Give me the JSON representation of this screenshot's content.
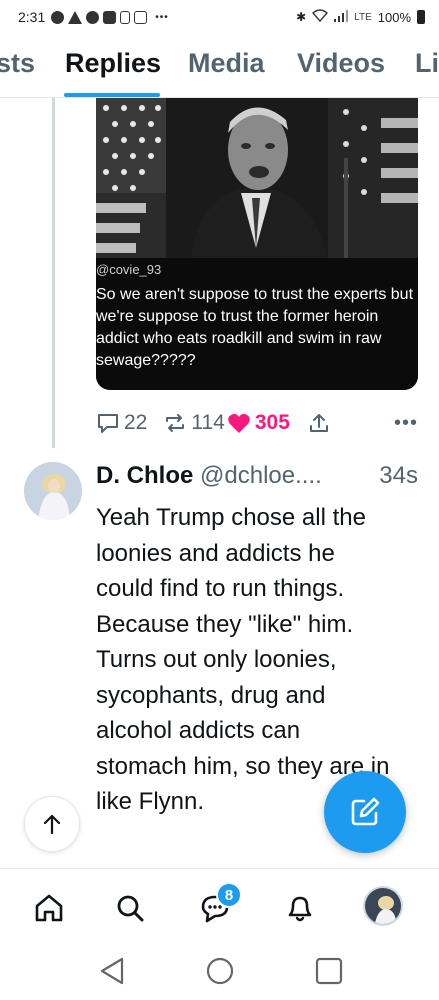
{
  "status_bar": {
    "time": "2:31",
    "network": "LTE",
    "battery": "100%",
    "icons": [
      "notification-icon",
      "warning-icon",
      "notification-icon",
      "youtube-icon",
      "sim-icon",
      "screen-icon",
      "more-dots-icon",
      "bluetooth-icon",
      "wifi-icon",
      "signal-icon",
      "battery-icon"
    ]
  },
  "tabs": [
    {
      "label": "sts",
      "active": false
    },
    {
      "label": "Replies",
      "active": true
    },
    {
      "label": "Media",
      "active": false
    },
    {
      "label": "Videos",
      "active": false
    },
    {
      "label": "Li",
      "active": false
    }
  ],
  "quoted_post": {
    "meme_handle": "@covie_93",
    "meme_text": "So we aren't suppose to trust the experts but we're suppose to trust the former heroin addict who eats roadkill and swim in raw sewage?????",
    "replies": "22",
    "reposts": "114",
    "likes": "305"
  },
  "reply": {
    "name": "D. Chloe",
    "handle": "@dchloe....",
    "time": "34s",
    "text": "Yeah Trump chose all the loonies and addicts he could find to run things. Because they \"like\" him.  Turns out only loonies, sycophants, drug and alcohol addicts can stomach him, so they are in like Flynn."
  },
  "bottom_nav": {
    "items": [
      "home-icon",
      "search-icon",
      "messages-icon",
      "notifications-icon",
      "profile-avatar"
    ],
    "messages_badge": "8"
  },
  "colors": {
    "accent": "#1d9bf0",
    "like": "#f91880",
    "muted": "#536471",
    "text": "#0f1419"
  }
}
